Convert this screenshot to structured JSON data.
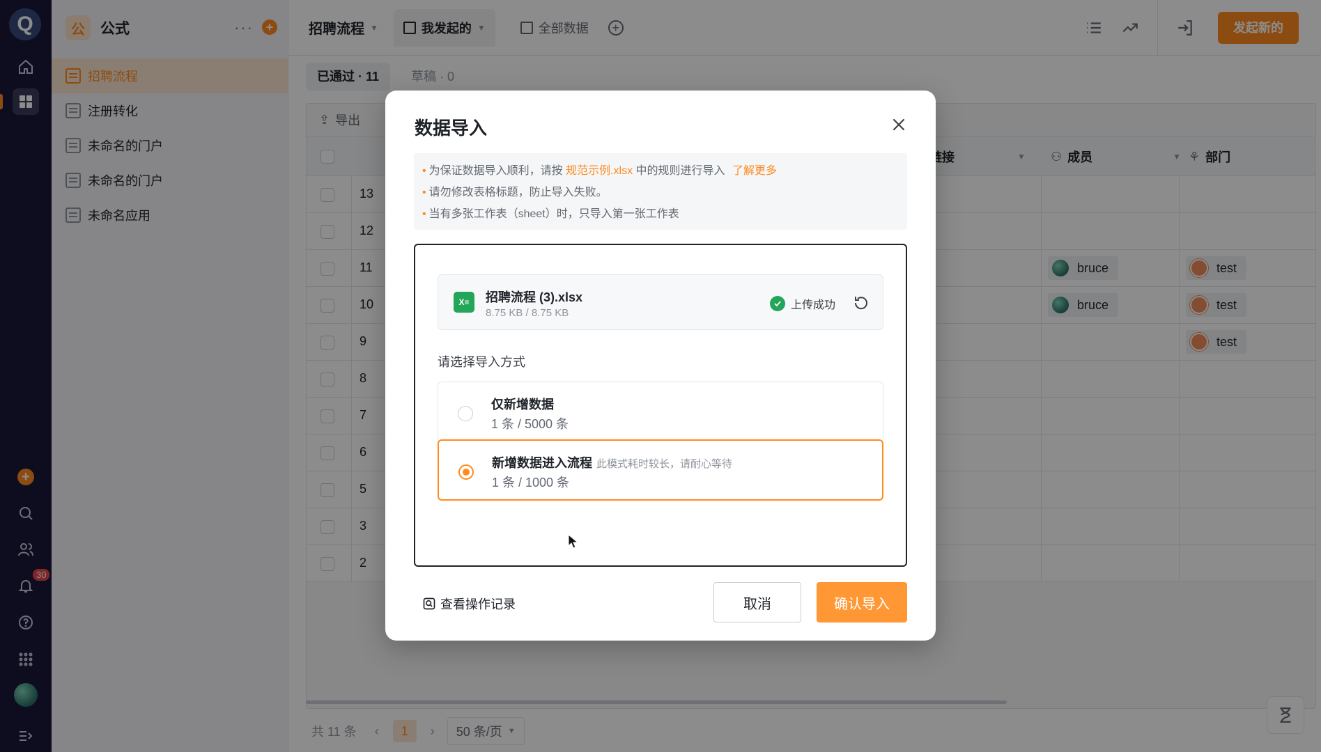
{
  "rail": {
    "logo": "Q",
    "notification_count": "30"
  },
  "sidebar": {
    "app_icon": "公",
    "app_name": "公式",
    "more": "···",
    "items": [
      {
        "label": "招聘流程",
        "active": true
      },
      {
        "label": "注册转化",
        "active": false
      },
      {
        "label": "未命名的门户",
        "active": false
      },
      {
        "label": "未命名的门户",
        "active": false
      },
      {
        "label": "未命名应用",
        "active": false
      }
    ]
  },
  "topbar": {
    "title": "招聘流程",
    "tabs": [
      {
        "label": "我发起的",
        "active": true
      },
      {
        "label": "全部数据",
        "active": false
      }
    ],
    "launch_label": "发起新的"
  },
  "subtabs": [
    {
      "label": "已通过 · 11",
      "active": true
    },
    {
      "label": "草稿 · 0",
      "active": false
    }
  ],
  "toolbar": {
    "export_label": "导出"
  },
  "grid": {
    "columns": [
      {
        "label": "链接"
      },
      {
        "label": "成员"
      },
      {
        "label": "部门"
      }
    ],
    "rows": [
      {
        "num": "13",
        "member": "",
        "dept": ""
      },
      {
        "num": "12",
        "member": "",
        "dept": ""
      },
      {
        "num": "11",
        "member": "bruce",
        "dept": "test"
      },
      {
        "num": "10",
        "member": "bruce",
        "dept": "test"
      },
      {
        "num": "9",
        "member": "",
        "dept": "test"
      },
      {
        "num": "8",
        "member": "",
        "dept": ""
      },
      {
        "num": "7",
        "member": "",
        "dept": ""
      },
      {
        "num": "6",
        "member": "",
        "dept": ""
      },
      {
        "num": "5",
        "member": "",
        "dept": ""
      },
      {
        "num": "3",
        "member": "",
        "dept": ""
      },
      {
        "num": "2",
        "member": "",
        "dept": ""
      }
    ]
  },
  "pager": {
    "total": "共 11 条",
    "current_page": "1",
    "page_size": "50 条/页"
  },
  "modal": {
    "title": "数据导入",
    "tips": {
      "t1_prefix": "为保证数据导入顺利，请按 ",
      "t1_link": "规范示例.xlsx",
      "t1_mid": " 中的规则进行导入 ",
      "t1_more": "了解更多",
      "t2": "请勿修改表格标题，防止导入失败。",
      "t3": "当有多张工作表（sheet）时，只导入第一张工作表"
    },
    "file": {
      "name": "招聘流程 (3).xlsx",
      "size": "8.75 KB / 8.75 KB",
      "status": "上传成功"
    },
    "choose_label": "请选择导入方式",
    "options": [
      {
        "title": "仅新增数据",
        "hint": "",
        "limit": "1 条 / 5000 条",
        "selected": false
      },
      {
        "title": "新增数据进入流程",
        "hint": "此模式耗时较长，请耐心等待",
        "limit": "1 条 / 1000 条",
        "selected": true
      }
    ],
    "history_label": "查看操作记录",
    "cancel_label": "取消",
    "confirm_label": "确认导入"
  },
  "colors": {
    "accent": "#ff8a1f",
    "rail_bg": "#18193a",
    "success": "#23a55a"
  }
}
